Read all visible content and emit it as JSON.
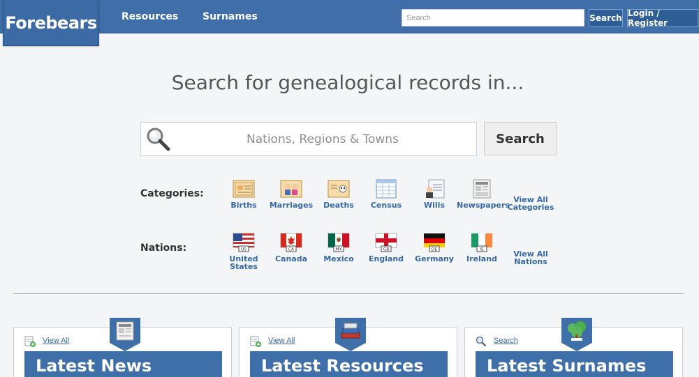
{
  "header": {
    "logo": "Forebears",
    "nav": [
      "Resources",
      "Surnames"
    ],
    "search_placeholder": "Search",
    "search_button": "Search",
    "login_button": "Login / Register"
  },
  "hero": {
    "title": "Search for genealogical records in...",
    "search_placeholder": "Nations, Regions & Towns",
    "search_button": "Search"
  },
  "categories": {
    "label": "Categories:",
    "items": [
      "Births",
      "Marriages",
      "Deaths",
      "Census",
      "Wills",
      "Newspapers"
    ],
    "view_all": [
      "View All",
      "Categories"
    ]
  },
  "nations": {
    "label": "Nations:",
    "items": [
      {
        "name": [
          "United",
          "States"
        ],
        "code": "US"
      },
      {
        "name": [
          "Canada"
        ],
        "code": "CA"
      },
      {
        "name": [
          "Mexico"
        ],
        "code": "MX"
      },
      {
        "name": [
          "England"
        ],
        "code": "GB"
      },
      {
        "name": [
          "Germany"
        ],
        "code": "DE"
      },
      {
        "name": [
          "Ireland"
        ],
        "code": "IE"
      }
    ],
    "view_all": [
      "View All",
      "Nations"
    ]
  },
  "panels": [
    {
      "link": "View All",
      "title": "Latest News",
      "icon": "newspaper-icon"
    },
    {
      "link": "View All",
      "title": "Latest Resources",
      "icon": "books-icon"
    },
    {
      "link": "Search",
      "title": "Latest Surnames",
      "icon": "tree-icon"
    }
  ],
  "colors": {
    "brand": "#3f6ea8",
    "link": "#3569a6"
  }
}
